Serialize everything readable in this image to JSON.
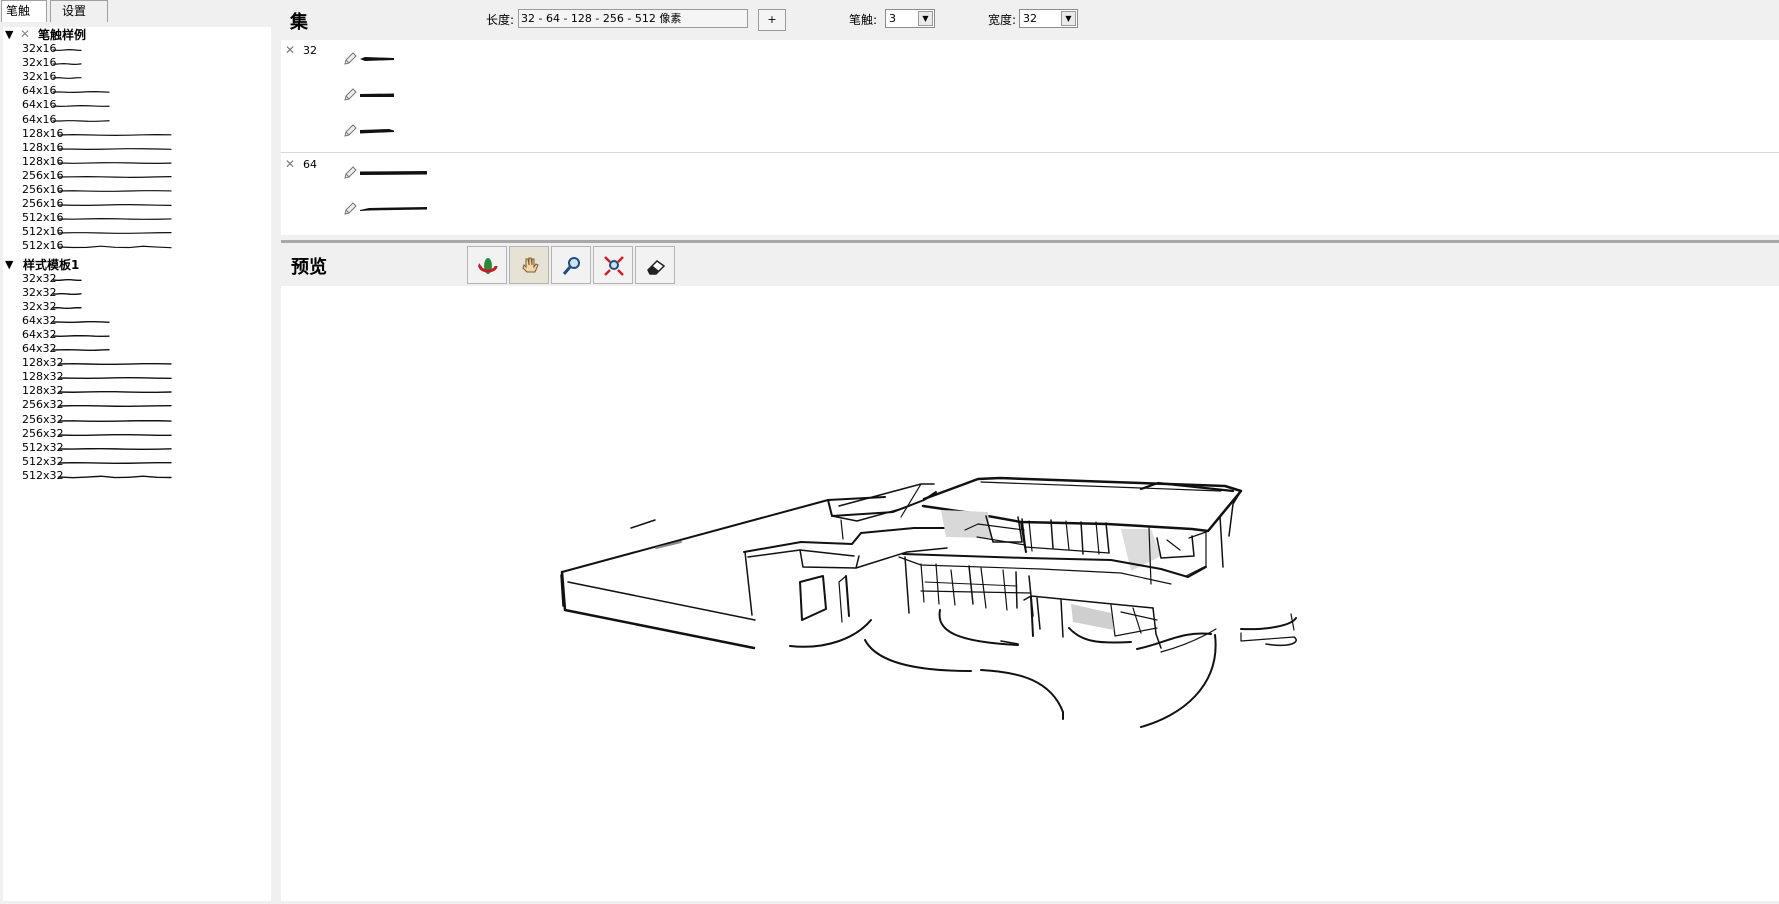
{
  "tabs": [
    "笔触",
    "设置"
  ],
  "groups": [
    {
      "label": "笔触样例",
      "items": [
        "32x16",
        "32x16",
        "32x16",
        "64x16",
        "64x16",
        "64x16",
        "128x16",
        "128x16",
        "128x16",
        "256x16",
        "256x16",
        "256x16",
        "512x16",
        "512x16",
        "512x16"
      ]
    },
    {
      "label": "样式模板1",
      "items": [
        "32x32",
        "32x32",
        "32x32",
        "64x32",
        "64x32",
        "64x32",
        "128x32",
        "128x32",
        "128x32",
        "256x32",
        "256x32",
        "256x32",
        "512x32",
        "512x32",
        "512x32"
      ]
    }
  ],
  "set": {
    "title": "集",
    "length_label": "长度:",
    "length_value": "32 - 64 - 128 - 256 - 512 像素",
    "add_label": "+",
    "stroke_label": "笔触:",
    "stroke_value": "3",
    "width_label": "宽度:",
    "width_value": "32",
    "rows": [
      {
        "size": "32",
        "strokes": 3
      },
      {
        "size": "64",
        "strokes": 2
      }
    ]
  },
  "preview": {
    "title": "预览",
    "tools": [
      "orbit-icon",
      "pan-hand-icon",
      "zoom-icon",
      "zoom-extents-icon",
      "eraser-icon"
    ]
  }
}
